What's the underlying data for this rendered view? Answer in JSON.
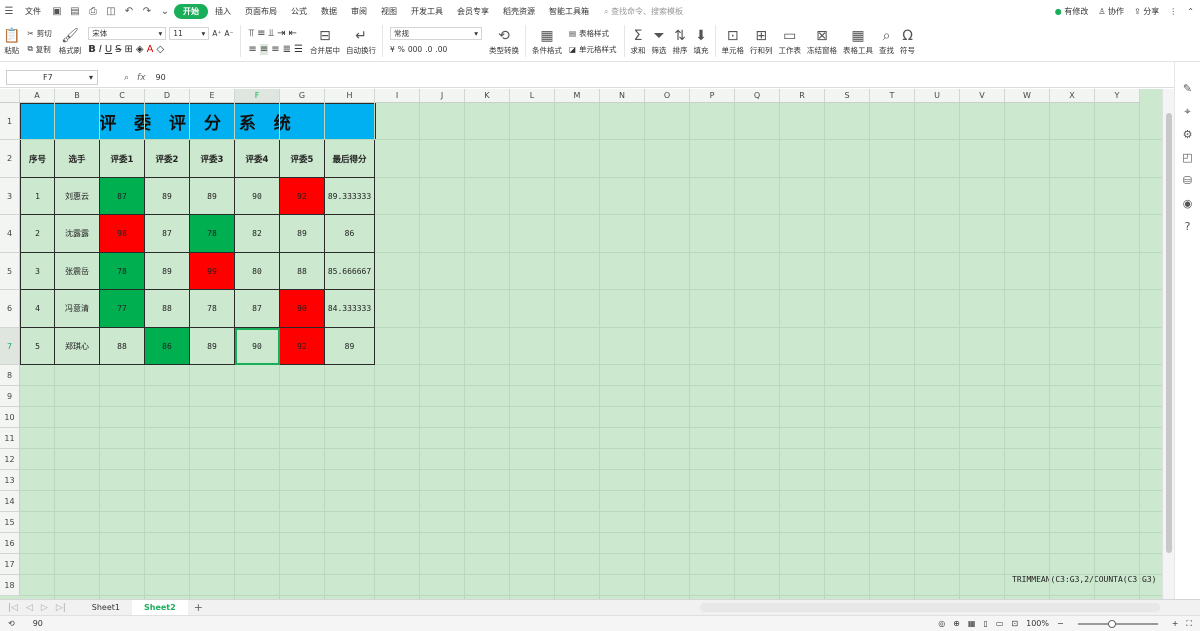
{
  "menubar": {
    "file": "文件",
    "tabs": [
      "开始",
      "插入",
      "页面布局",
      "公式",
      "数据",
      "审阅",
      "视图",
      "开发工具",
      "会员专享",
      "稻壳资源",
      "智能工具箱"
    ],
    "search_placeholder": "查找命令、搜索模板",
    "has_changes": "有修改",
    "collab": "协作",
    "share": "分享"
  },
  "ribbon": {
    "paste": "粘贴",
    "cut": "剪切",
    "copy": "复制",
    "format_painter": "格式刷",
    "font_name": "宋体",
    "font_size": "11",
    "merge": "合并居中",
    "wrap": "自动换行",
    "number_format": "常规",
    "type_convert": "类型转换",
    "cond_format": "条件格式",
    "table_style": "表格样式",
    "cell_style": "单元格样式",
    "sum": "求和",
    "filter": "筛选",
    "sort": "排序",
    "fill": "填充",
    "cells": "单元格",
    "rowcol": "行和列",
    "worksheet": "工作表",
    "freeze": "冻结窗格",
    "table_tools": "表格工具",
    "find": "查找",
    "symbol": "符号"
  },
  "formula_bar": {
    "cell_ref": "F7",
    "value": "90"
  },
  "columns": [
    "A",
    "B",
    "C",
    "D",
    "E",
    "F",
    "G",
    "H",
    "I",
    "J",
    "K",
    "L",
    "M",
    "N",
    "O",
    "P",
    "Q",
    "R",
    "S",
    "T",
    "U",
    "V",
    "W",
    "X",
    "Y"
  ],
  "rows": [
    "1",
    "2",
    "3",
    "4",
    "5",
    "6",
    "7",
    "8",
    "9",
    "10",
    "11",
    "12",
    "13",
    "14",
    "15",
    "16",
    "17",
    "18"
  ],
  "table": {
    "title": "评 委 评 分 系 统",
    "headers": [
      "序号",
      "选手",
      "评委1",
      "评委2",
      "评委3",
      "评委4",
      "评委5",
      "最后得分"
    ],
    "data": [
      [
        "1",
        "刘惠云",
        "87",
        "89",
        "89",
        "90",
        "92",
        "89.333333"
      ],
      [
        "2",
        "沈露露",
        "98",
        "87",
        "78",
        "82",
        "89",
        "86"
      ],
      [
        "3",
        "张震岳",
        "78",
        "89",
        "99",
        "80",
        "88",
        "85.666667"
      ],
      [
        "4",
        "冯意清",
        "77",
        "88",
        "78",
        "87",
        "90",
        "84.333333"
      ],
      [
        "5",
        "郑琪心",
        "88",
        "86",
        "89",
        "90",
        "92",
        "89"
      ]
    ],
    "highlights": {
      "green": "#00b050",
      "red": "#ff0000"
    },
    "cell_colors": [
      [
        "",
        "",
        "green",
        "",
        "",
        "",
        "red",
        ""
      ],
      [
        "",
        "",
        "red",
        "",
        "green",
        "",
        "",
        ""
      ],
      [
        "",
        "",
        "green",
        "",
        "red",
        "",
        "",
        ""
      ],
      [
        "",
        "",
        "green",
        "",
        "",
        "",
        "red",
        ""
      ],
      [
        "",
        "",
        "",
        "green",
        "",
        "",
        "red",
        ""
      ]
    ]
  },
  "note": "TRIMMEAN(C3:G3,2/COUNTA(C3:G3)",
  "sheets": [
    "Sheet1",
    "Sheet2"
  ],
  "active_sheet": "Sheet2",
  "status": {
    "value": "90",
    "zoom": "100%"
  }
}
